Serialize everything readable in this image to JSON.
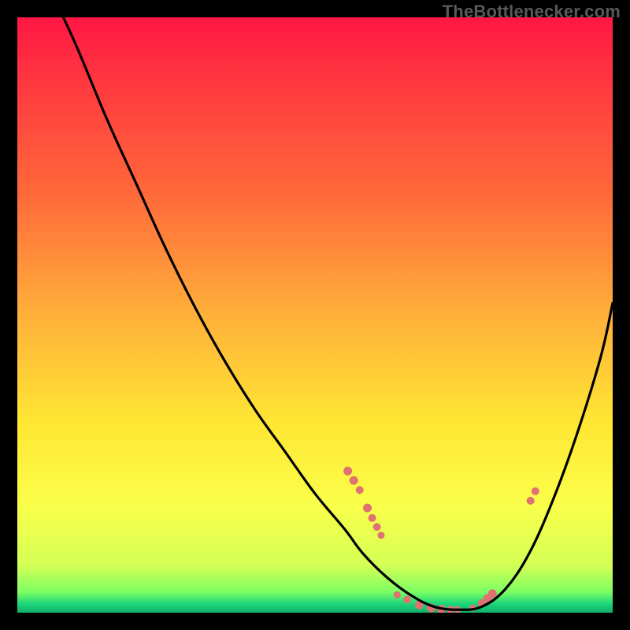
{
  "watermark": "TheBottlenecker.com",
  "chart_data": {
    "type": "line",
    "title": "",
    "xlabel": "",
    "ylabel": "",
    "xlim": [
      0,
      100
    ],
    "ylim": [
      0,
      100
    ],
    "grid": false,
    "background_gradient": {
      "stops": [
        {
          "offset": 0.0,
          "color": "#ff1744"
        },
        {
          "offset": 0.12,
          "color": "#ff3b3f"
        },
        {
          "offset": 0.3,
          "color": "#ff6a3a"
        },
        {
          "offset": 0.5,
          "color": "#ffb03a"
        },
        {
          "offset": 0.68,
          "color": "#ffe633"
        },
        {
          "offset": 0.82,
          "color": "#faff4a"
        },
        {
          "offset": 0.92,
          "color": "#d4ff55"
        },
        {
          "offset": 0.965,
          "color": "#7dff62"
        },
        {
          "offset": 0.985,
          "color": "#1dd67b"
        },
        {
          "offset": 1.0,
          "color": "#0fb06a"
        }
      ]
    },
    "series": [
      {
        "name": "bottleneck-curve",
        "color": "#000000",
        "x": [
          0,
          5,
          10,
          15,
          20,
          25,
          30,
          35,
          40,
          45,
          50,
          55,
          58,
          62,
          66,
          70,
          74,
          78,
          82,
          86,
          90,
          94,
          98,
          100
        ],
        "y": [
          118,
          106,
          95,
          83,
          72,
          61,
          51,
          42,
          34,
          27,
          20,
          14,
          10,
          6,
          3,
          1,
          0.5,
          1,
          4,
          10,
          19,
          30,
          43,
          52
        ]
      }
    ],
    "markers": [
      {
        "name": "cluster-left-upper",
        "color": "#e07272",
        "points": [
          {
            "x": 55.5,
            "y": 23.8,
            "r": 5.5
          },
          {
            "x": 56.5,
            "y": 22.2,
            "r": 5.5
          },
          {
            "x": 57.5,
            "y": 20.6,
            "r": 5
          }
        ]
      },
      {
        "name": "cluster-left-lower",
        "color": "#e07272",
        "points": [
          {
            "x": 58.8,
            "y": 17.6,
            "r": 5.5
          },
          {
            "x": 59.6,
            "y": 15.9,
            "r": 5
          },
          {
            "x": 60.4,
            "y": 14.4,
            "r": 5
          },
          {
            "x": 61.1,
            "y": 13.0,
            "r": 4.5
          }
        ]
      },
      {
        "name": "bottom-band",
        "color": "#e07272",
        "points": [
          {
            "x": 63.8,
            "y": 3.0,
            "r": 4.5
          },
          {
            "x": 65.5,
            "y": 2.2,
            "r": 5
          },
          {
            "x": 67.5,
            "y": 1.3,
            "r": 5.5
          },
          {
            "x": 69.5,
            "y": 0.8,
            "r": 5.5
          },
          {
            "x": 71.2,
            "y": 0.6,
            "r": 5.5
          },
          {
            "x": 72.8,
            "y": 0.5,
            "r": 5
          },
          {
            "x": 74.0,
            "y": 0.5,
            "r": 4.5
          },
          {
            "x": 76.5,
            "y": 0.8,
            "r": 4.5
          },
          {
            "x": 78.0,
            "y": 1.6,
            "r": 5
          },
          {
            "x": 79.0,
            "y": 2.4,
            "r": 5.5
          },
          {
            "x": 79.8,
            "y": 3.2,
            "r": 5.5
          }
        ]
      },
      {
        "name": "right-pair",
        "color": "#e07272",
        "points": [
          {
            "x": 86.2,
            "y": 18.8,
            "r": 5
          },
          {
            "x": 87.0,
            "y": 20.4,
            "r": 5
          }
        ]
      }
    ]
  }
}
